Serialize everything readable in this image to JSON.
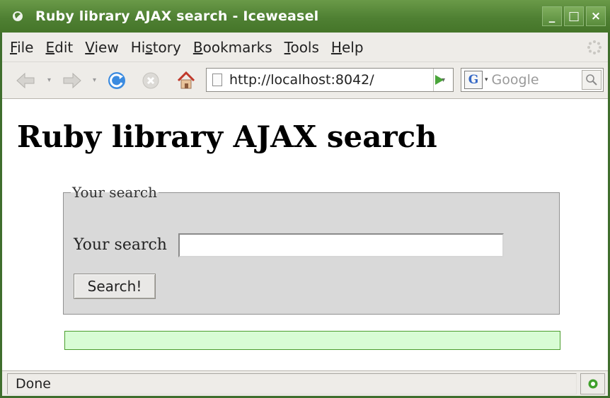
{
  "window": {
    "title": "Ruby library AJAX search - Iceweasel",
    "buttons": {
      "minimize": "_",
      "maximize": "□",
      "close": "×"
    }
  },
  "menu": {
    "items": [
      {
        "label": "File",
        "accel": "F",
        "rest": "ile"
      },
      {
        "label": "Edit",
        "accel": "E",
        "rest": "dit"
      },
      {
        "label": "View",
        "accel": "V",
        "rest": "iew"
      },
      {
        "label": "History",
        "prefix": "Hi",
        "accel": "s",
        "rest": "tory"
      },
      {
        "label": "Bookmarks",
        "accel": "B",
        "rest": "ookmarks"
      },
      {
        "label": "Tools",
        "accel": "T",
        "rest": "ools"
      },
      {
        "label": "Help",
        "accel": "H",
        "rest": "elp"
      }
    ]
  },
  "toolbar": {
    "icons": [
      "back-arrow-icon",
      "forward-arrow-icon",
      "reload-icon",
      "stop-icon",
      "home-icon"
    ],
    "url": "http://localhost:8042/",
    "search_engine_letter": "G",
    "search_placeholder": "Google"
  },
  "page": {
    "heading": "Ruby library AJAX search",
    "fieldset_legend": "Your search",
    "field_label": "Your search",
    "field_value": "",
    "submit_label": "Search!",
    "results_text": ""
  },
  "status": {
    "text": "Done"
  },
  "colors": {
    "titlebar": "#4f8033",
    "fieldset_bg": "#d9d9d9",
    "results_bg": "#d8fcd4",
    "results_border": "#4a9d2c"
  }
}
